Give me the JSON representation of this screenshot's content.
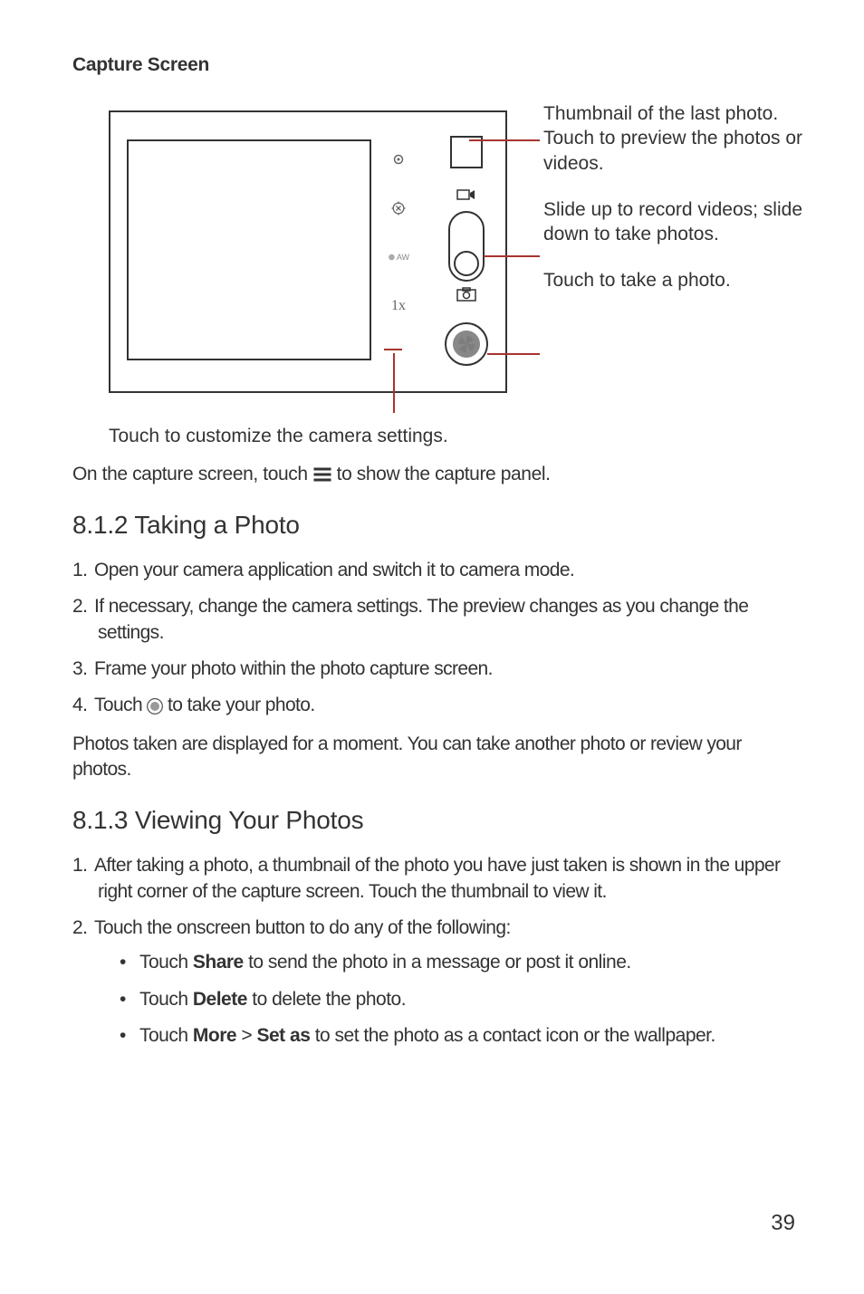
{
  "heading": "Capture Screen",
  "icons": {
    "zoom_label": "1x",
    "aw_label": "AW"
  },
  "callout_thumbnail": "Thumbnail of the last photo. Touch to preview the photos or videos.",
  "callout_slider": "Slide up to record videos; slide down to take photos.",
  "callout_shutter": "Touch to take a photo.",
  "callout_settings": "Touch to customize the camera settings.",
  "panel_line_pre": "On the capture screen, touch",
  "panel_line_post": "to show the capture panel.",
  "sec812_title": "8.1.2  Taking a Photo",
  "sec812_items": [
    "Open your camera application and switch it to camera mode.",
    "If necessary, change the camera settings. The preview changes as you change the settings.",
    "Frame your photo within the photo capture screen."
  ],
  "sec812_item4_pre": "Touch",
  "sec812_item4_post": "to take your photo.",
  "sec812_after": "Photos taken are displayed for a moment. You can take another photo or review your photos.",
  "sec813_title": "8.1.3  Viewing Your Photos",
  "sec813_item1": "After taking a photo, a thumbnail of the photo you have just taken is shown in the upper right corner of the capture screen. Touch the thumbnail to view it.",
  "sec813_item2": "Touch the onscreen button to do any of the following:",
  "sec813_sub": [
    {
      "pre": "Touch ",
      "bold": "Share",
      "post": " to send the photo in a message or post it online."
    },
    {
      "pre": "Touch ",
      "bold": "Delete",
      "post": " to delete the photo."
    },
    {
      "pre": "Touch ",
      "bold": "More",
      "mid": " > ",
      "bold2": "Set as",
      "post": " to set the photo as a contact icon or the wallpaper."
    }
  ],
  "page_number": "39"
}
